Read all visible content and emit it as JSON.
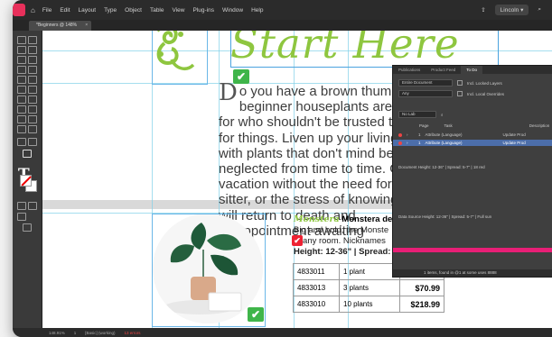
{
  "menubar": {
    "items": [
      "File",
      "Edit",
      "Layout",
      "Type",
      "Object",
      "Table",
      "View",
      "Plug-ins",
      "Window",
      "Help"
    ],
    "right_label": "Lincoln"
  },
  "document_tab": {
    "title": "*Beginners @ 148%",
    "close": "×"
  },
  "canvas": {
    "heading": "Start Here",
    "body_dropcap": "D",
    "body_text": "o you have a brown thumb? beginner houseplants are perfect for who shouldn't be trusted to care for things. Liven up your living space with plants that don't mind being neglected from time to time. Go on vacation without the need for a plant-sitter, or the stress of knowing you will return to death and disappointment awaiting",
    "sub_heading_green": "Monstera",
    "sub_heading_bold": "Monstera delic",
    "sub_body_lines": [
      "Big and bold, the Monste",
      "in any room. Nicknames",
      "Height: 12-36\" | Spread:"
    ],
    "price_rows": [
      {
        "sku": "4833011",
        "qty": "1 plant",
        "price": ""
      },
      {
        "sku": "4833013",
        "qty": "3 plants",
        "price": "$70.99"
      },
      {
        "sku": "4833010",
        "qty": "10 plants",
        "price": "$218.99"
      }
    ]
  },
  "panel": {
    "tabs": [
      "Publications",
      "Product Feed",
      "To Do"
    ],
    "active_tab": "To Do",
    "dropdown1": "Entire Document",
    "checkbox1": "Incl. Locked Layers",
    "dropdown2": "Any",
    "checkbox2": "Incl. Local Overrides",
    "filter_label": "No Lab",
    "columns": [
      "Page",
      "Task",
      "Description"
    ],
    "rows": [
      {
        "page": "1",
        "task": "Attribute (Language)",
        "desc": "Update Prod"
      },
      {
        "page": "1",
        "task": "Attribute (Language)",
        "desc": "Update Prod"
      }
    ],
    "document_line": "Document   Height: 12-36\" | Spread: 5-7\" | 18 red",
    "data_source_line": "Data Source   Height: 12-36\" | Spread: 5-7\" | Full sun",
    "footer_text": "1 items, found in @1 at some uses 8888"
  },
  "status": {
    "zoom": "148.91%",
    "page": "1",
    "profile": "[Basic] (working)",
    "errors": "13 errors"
  },
  "colors": {
    "accent_green": "#8ec63f",
    "check_green": "#3fb54a",
    "guide_blue": "#7fd0e8",
    "pink": "#e81f76"
  }
}
